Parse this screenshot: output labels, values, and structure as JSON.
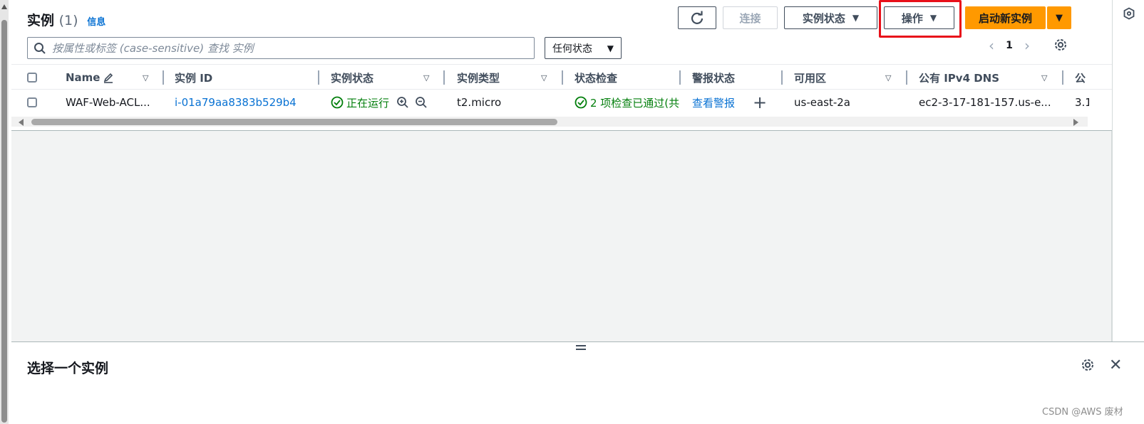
{
  "header": {
    "title": "实例",
    "count": "(1)",
    "info_link": "信息"
  },
  "toolbar": {
    "connect_label": "连接",
    "instance_state_label": "实例状态",
    "actions_label": "操作",
    "launch_label": "启动新实例"
  },
  "search": {
    "placeholder": "按属性或标签 (case-sensitive) 查找 实例"
  },
  "filter": {
    "selected": "任何状态"
  },
  "pagination": {
    "page": "1"
  },
  "columns": [
    {
      "label": "Name"
    },
    {
      "label": "实例 ID"
    },
    {
      "label": "实例状态"
    },
    {
      "label": "实例类型"
    },
    {
      "label": "状态检查"
    },
    {
      "label": "警报状态"
    },
    {
      "label": "可用区"
    },
    {
      "label": "公有 IPv4 DNS"
    },
    {
      "label": "公"
    }
  ],
  "rows": [
    {
      "name": "WAF-Web-ACL...",
      "instance_id": "i-01a79aa8383b529b4",
      "state": "正在运行",
      "type": "t2.micro",
      "status_check": "2 项检查已通过(共",
      "alarm": "查看警报",
      "zone": "us-east-2a",
      "dns": "ec2-3-17-181-157.us-e...",
      "ip": "3.1"
    }
  ],
  "split_panel": {
    "title": "选择一个实例"
  },
  "watermark": "CSDN @AWS 废材",
  "colors": {
    "accent_orange": "#ff9900",
    "link_blue": "#0972d3",
    "success_green": "#037f0c",
    "highlight_red": "#e8101a"
  }
}
